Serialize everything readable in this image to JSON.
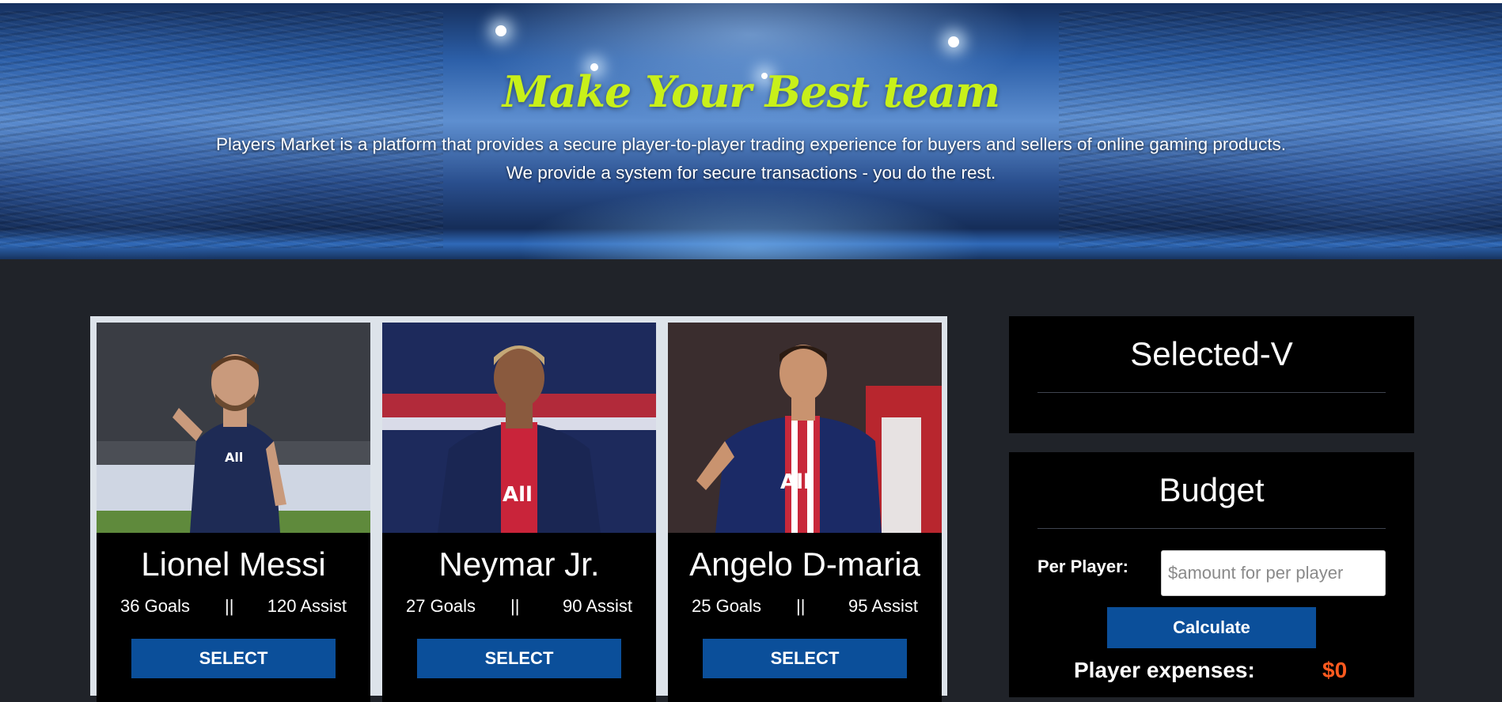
{
  "hero": {
    "title": "Make Your Best team",
    "subtitle_line1": "Players Market is a platform that provides a secure player-to-player trading experience for buyers and sellers of online gaming products.",
    "subtitle_line2": "We provide a system for secure transactions - you do the rest."
  },
  "players": [
    {
      "name": "Lionel Messi",
      "goals": "36 Goals",
      "separator": "||",
      "assist": "120 Assist",
      "select_label": "SELECT",
      "photo_icon": "player-photo-icon"
    },
    {
      "name": "Neymar Jr.",
      "goals": "27 Goals",
      "separator": "||",
      "assist": "90 Assist",
      "select_label": "SELECT",
      "photo_icon": "player-photo-icon"
    },
    {
      "name": "Angelo D-maria",
      "goals": "25 Goals",
      "separator": "||",
      "assist": "95 Assist",
      "select_label": "SELECT",
      "photo_icon": "player-photo-icon"
    }
  ],
  "selected": {
    "title": "Selected-V"
  },
  "budget": {
    "title": "Budget",
    "per_player_label": "Per Player:",
    "per_player_placeholder": "$amount for per player",
    "per_player_value": "",
    "calculate_label": "Calculate",
    "expenses_label": "Player expenses:",
    "expenses_value": "$0"
  },
  "colors": {
    "title_accent": "#c8f01a",
    "button_blue": "#0b4f9a",
    "expense_orange": "#ff5a1f",
    "page_bg": "#202329"
  }
}
